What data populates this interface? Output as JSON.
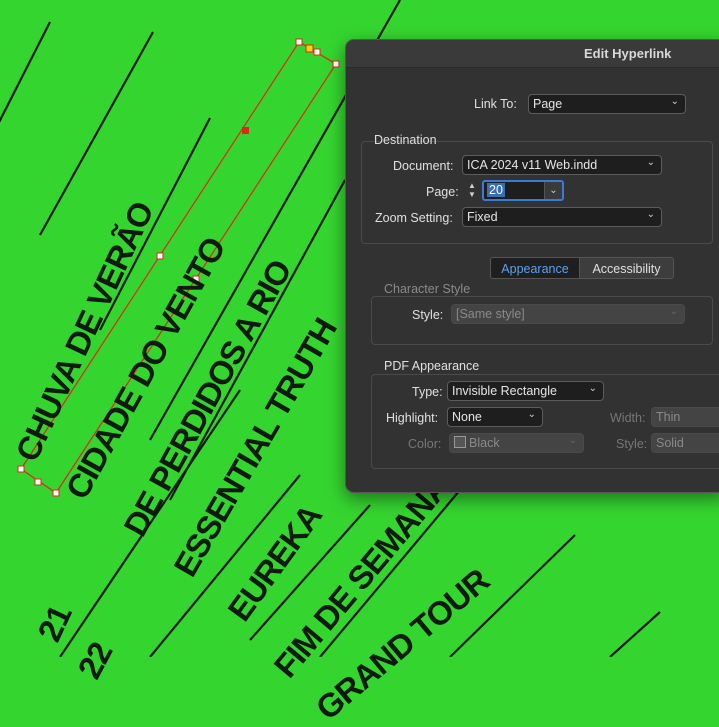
{
  "canvas": {
    "titles": [
      "CHUVA DE VERÃO",
      "CIDADE DO VENTO",
      "DE PERDIDOS A RIO",
      "ESSENTIAL TRUTH",
      "EUREKA",
      "FIM DE SEMANA",
      "GRAND TOUR"
    ],
    "numbers": [
      "21",
      "22"
    ],
    "background_color": "#35d530"
  },
  "dialog": {
    "title": "Edit Hyperlink",
    "link_to_label": "Link To:",
    "link_to_value": "Page",
    "destination": {
      "group_title": "Destination",
      "document_label": "Document:",
      "document_value": "ICA 2024 v11 Web.indd",
      "page_label": "Page:",
      "page_value": "20",
      "zoom_label": "Zoom Setting:",
      "zoom_value": "Fixed"
    },
    "tabs": [
      {
        "label": "Appearance",
        "active": true
      },
      {
        "label": "Accessibility",
        "active": false
      }
    ],
    "character_style": {
      "group_title": "Character Style",
      "style_label": "Style:",
      "style_value": "[Same style]"
    },
    "pdf_appearance": {
      "group_title": "PDF Appearance",
      "type_label": "Type:",
      "type_value": "Invisible Rectangle",
      "highlight_label": "Highlight:",
      "highlight_value": "None",
      "width_label": "Width:",
      "width_value": "Thin",
      "color_label": "Color:",
      "color_value": "Black",
      "style_label": "Style:",
      "style_value": "Solid"
    }
  }
}
